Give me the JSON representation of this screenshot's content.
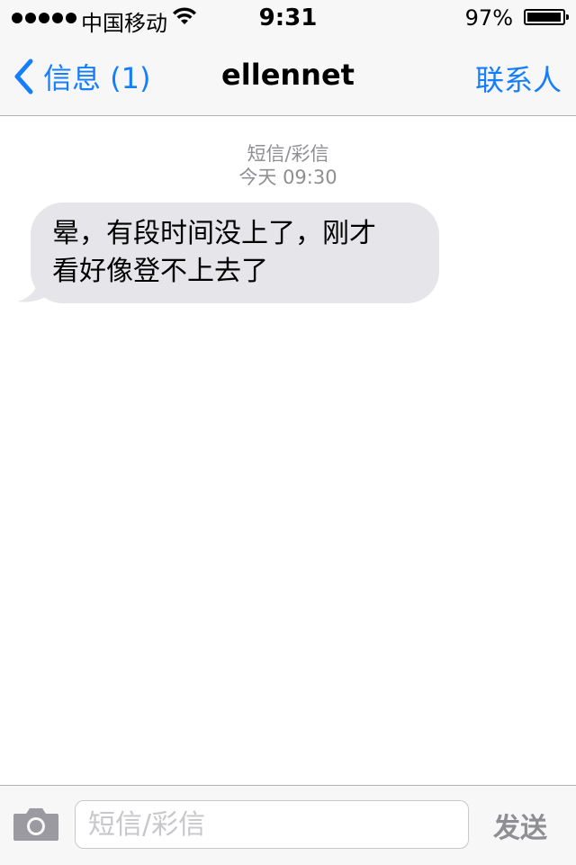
{
  "status_bar": {
    "carrier": "中国移动",
    "time": "9:31",
    "battery_percent": "97%",
    "battery_level": 0.97,
    "signal_dots": 5,
    "icons": [
      "signal-dots-icon",
      "wifi-icon",
      "battery-icon"
    ]
  },
  "nav": {
    "back_label": "信息 (1)",
    "title": "ellennet",
    "contacts_label": "联系人"
  },
  "thread": {
    "message_type": "短信/彩信",
    "timestamp": "今天 09:30",
    "messages": [
      {
        "direction": "incoming",
        "line1": "晕，有段时间没上了，刚才",
        "line2": "看好像登不上去了"
      }
    ]
  },
  "composer": {
    "placeholder": "短信/彩信",
    "value": "",
    "send_label": "发送"
  },
  "colors": {
    "accent": "#157efb",
    "incoming_bubble": "#e5e5ea",
    "bar_background": "#f7f7f7",
    "secondary_text": "#8e8e93"
  }
}
